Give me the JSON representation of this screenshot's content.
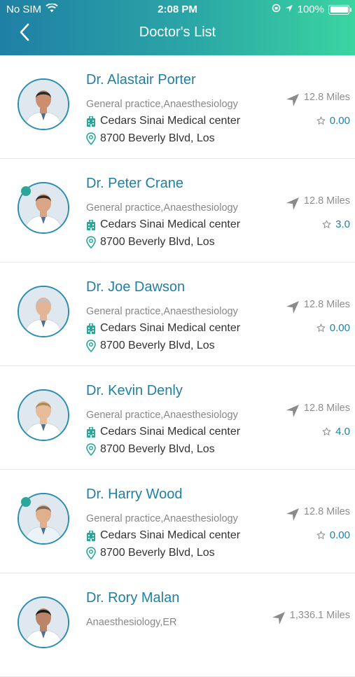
{
  "status": {
    "carrier": "No SIM",
    "time": "2:08 PM",
    "battery": "100%"
  },
  "header": {
    "title": "Doctor's List"
  },
  "doctors": [
    {
      "name": "Dr. Alastair Porter",
      "specialty": "General practice,Anaesthesiology",
      "hospital": "Cedars Sinai Medical center",
      "address": "8700 Beverly Blvd, Los",
      "distance": "12.8 Miles",
      "rating": "0.00",
      "online": false
    },
    {
      "name": "Dr. Peter Crane",
      "specialty": "General practice,Anaesthesiology",
      "hospital": "Cedars Sinai Medical center",
      "address": "8700 Beverly Blvd, Los",
      "distance": "12.8 Miles",
      "rating": "3.0",
      "online": true
    },
    {
      "name": "Dr. Joe Dawson",
      "specialty": "General practice,Anaesthesiology",
      "hospital": "Cedars Sinai Medical center",
      "address": "8700 Beverly Blvd, Los",
      "distance": "12.8 Miles",
      "rating": "0.00",
      "online": false
    },
    {
      "name": "Dr. Kevin Denly",
      "specialty": "General practice,Anaesthesiology",
      "hospital": "Cedars Sinai Medical center",
      "address": "8700 Beverly Blvd, Los",
      "distance": "12.8 Miles",
      "rating": "4.0",
      "online": false
    },
    {
      "name": "Dr. Harry Wood",
      "specialty": "General practice,Anaesthesiology",
      "hospital": "Cedars Sinai Medical center",
      "address": "8700 Beverly Blvd, Los",
      "distance": "12.8 Miles",
      "rating": "0.00",
      "online": true
    },
    {
      "name": "Dr. Rory Malan",
      "specialty": "Anaesthesiology,ER",
      "hospital": "",
      "address": "",
      "distance": "1,336.1 Miles",
      "rating": "",
      "online": false
    }
  ],
  "colors": {
    "accent": "#1f7fa5",
    "online": "#2aa79b",
    "gradient_start": "#1f7fa5",
    "gradient_end": "#3ad5a0"
  },
  "icons": {
    "back": "chevron-left-icon",
    "distance": "navigation-arrow-icon",
    "rating": "star-outline-icon",
    "hospital": "hospital-building-icon",
    "address": "map-pin-icon"
  }
}
